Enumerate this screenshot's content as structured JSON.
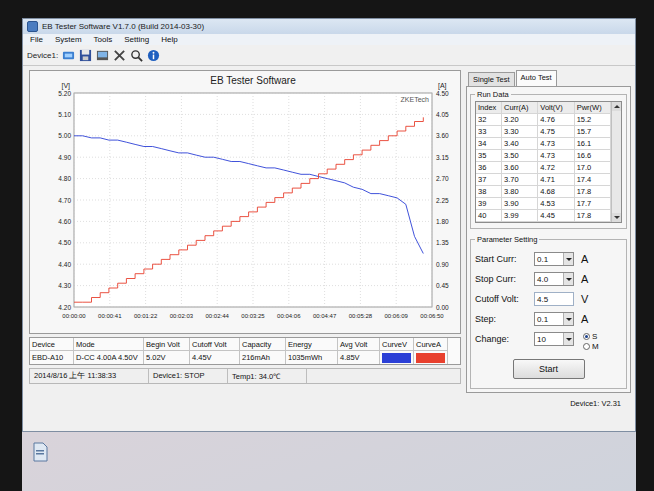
{
  "window": {
    "title": "EB Tester Software V1.7.0 (Build 2014-03-30)"
  },
  "menu": [
    "File",
    "System",
    "Tools",
    "Setting",
    "Help"
  ],
  "toolbar": {
    "label": "Device1:"
  },
  "chart": {
    "title": "EB Tester Software",
    "brand": "ZKETech",
    "left_unit": "[V]",
    "right_unit": "[A]",
    "left_ticks": [
      "5.20",
      "5.10",
      "5.00",
      "4.90",
      "4.80",
      "4.70",
      "4.60",
      "4.50",
      "4.40",
      "4.30",
      "4.20"
    ],
    "right_ticks": [
      "4.50",
      "4.05",
      "3.60",
      "3.15",
      "2.70",
      "2.25",
      "1.80",
      "1.35",
      "0.90",
      "0.45",
      "0.00"
    ],
    "x_ticks": [
      "00:00:00",
      "00:00:41",
      "00:01:22",
      "00:02:03",
      "00:02:44",
      "00:03:25",
      "00:04:06",
      "00:04:47",
      "00:05:28",
      "00:06:09",
      "00:06:50"
    ],
    "series": [
      {
        "name": "CurveV",
        "axis": "left",
        "color": "#2b3fd6",
        "values": [
          5.0,
          5.0,
          4.99,
          4.99,
          4.98,
          4.98,
          4.97,
          4.96,
          4.95,
          4.95,
          4.94,
          4.93,
          4.92,
          4.92,
          4.91,
          4.9,
          4.9,
          4.89,
          4.88,
          4.88,
          4.87,
          4.86,
          4.85,
          4.85,
          4.84,
          4.83,
          4.82,
          4.82,
          4.81,
          4.8,
          4.79,
          4.78,
          4.76,
          4.75,
          4.73,
          4.73,
          4.72,
          4.71,
          4.68,
          4.53,
          4.45
        ]
      },
      {
        "name": "CurveA",
        "axis": "right",
        "color": "#e8402e",
        "values": [
          0.1,
          0.1,
          0.2,
          0.3,
          0.4,
          0.5,
          0.6,
          0.7,
          0.8,
          0.9,
          1.0,
          1.1,
          1.2,
          1.3,
          1.4,
          1.5,
          1.6,
          1.7,
          1.8,
          1.9,
          2.0,
          2.1,
          2.2,
          2.3,
          2.4,
          2.5,
          2.6,
          2.7,
          2.8,
          2.9,
          3.0,
          3.1,
          3.2,
          3.3,
          3.4,
          3.5,
          3.6,
          3.7,
          3.8,
          3.9,
          3.99
        ]
      }
    ]
  },
  "summary": [
    {
      "label": "Device",
      "value": "EBD-A10"
    },
    {
      "label": "Mode",
      "value": "D-CC 4.00A 4.50V"
    },
    {
      "label": "Begin Volt",
      "value": "5.02V"
    },
    {
      "label": "Cutoff Volt",
      "value": "4.45V"
    },
    {
      "label": "Capacity",
      "value": "216mAh"
    },
    {
      "label": "Energy",
      "value": "1035mWh"
    },
    {
      "label": "Avg Volt",
      "value": "4.85V"
    }
  ],
  "legend": [
    {
      "label": "CurveV",
      "color": "#2b3fd6"
    },
    {
      "label": "CurveA",
      "color": "#e8402e"
    }
  ],
  "status_bar": [
    "2014/8/16 上午 11:38:33",
    "Device1: STOP",
    "Temp1: 34.0℃"
  ],
  "tabs": [
    {
      "label": "Single Test",
      "selected": false
    },
    {
      "label": "Auto Test",
      "selected": true
    }
  ],
  "run_data": {
    "title": "Run Data",
    "columns": [
      "Index",
      "Curr(A)",
      "Volt(V)",
      "Pwr(W)"
    ],
    "rows": [
      [
        "32",
        "3.20",
        "4.76",
        "15.2"
      ],
      [
        "33",
        "3.30",
        "4.75",
        "15.7"
      ],
      [
        "34",
        "3.40",
        "4.73",
        "16.1"
      ],
      [
        "35",
        "3.50",
        "4.73",
        "16.6"
      ],
      [
        "36",
        "3.60",
        "4.72",
        "17.0"
      ],
      [
        "37",
        "3.70",
        "4.71",
        "17.4"
      ],
      [
        "38",
        "3.80",
        "4.68",
        "17.8"
      ],
      [
        "39",
        "3.90",
        "4.53",
        "17.7"
      ],
      [
        "40",
        "3.99",
        "4.45",
        "17.8"
      ]
    ]
  },
  "parameters": {
    "title": "Parameter Setting",
    "fields": [
      {
        "label": "Start Curr:",
        "value": "0.1",
        "unit": "A",
        "kind": "select"
      },
      {
        "label": "Stop Curr:",
        "value": "4.0",
        "unit": "A",
        "kind": "select"
      },
      {
        "label": "Cutoff Volt:",
        "value": "4.5",
        "unit": "V",
        "kind": "input"
      },
      {
        "label": "Step:",
        "value": "0.1",
        "unit": "A",
        "kind": "select"
      },
      {
        "label": "Change:",
        "value": "10",
        "unit": "",
        "kind": "select",
        "radios": [
          {
            "label": "S",
            "selected": true
          },
          {
            "label": "M",
            "selected": false
          }
        ]
      }
    ],
    "button": "Start"
  },
  "device_version": "Device1: V2.31"
}
